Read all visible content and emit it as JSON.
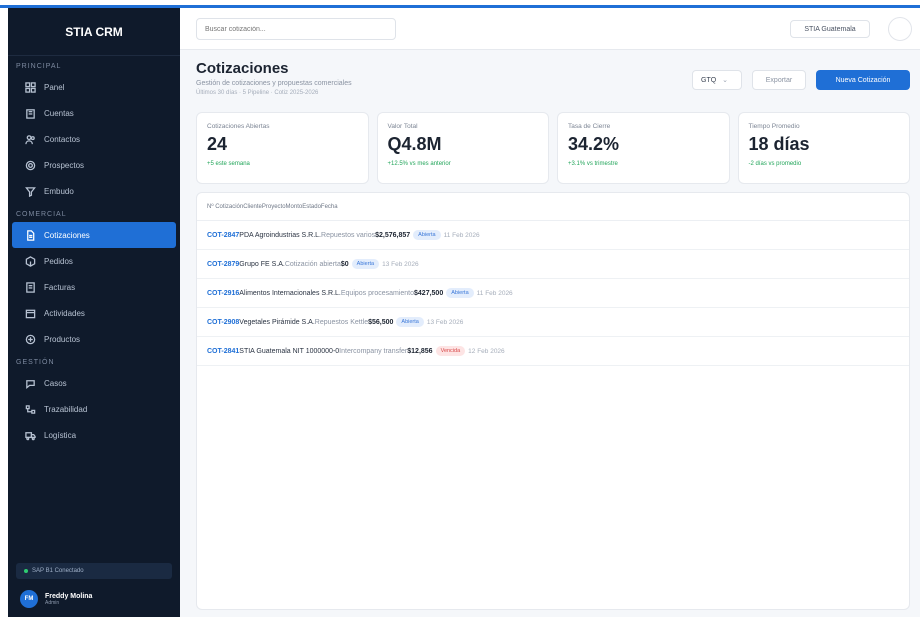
{
  "brand": "STIA CRM",
  "sidebar": {
    "sections": [
      {
        "label": "PRINCIPAL",
        "items": [
          {
            "label": "Panel",
            "icon": "grid-icon"
          },
          {
            "label": "Cuentas",
            "icon": "building-icon"
          },
          {
            "label": "Contactos",
            "icon": "users-icon"
          },
          {
            "label": "Prospectos",
            "icon": "target-icon"
          },
          {
            "label": "Embudo",
            "icon": "funnel-icon"
          }
        ]
      },
      {
        "label": "COMERCIAL",
        "items": [
          {
            "label": "Cotizaciones",
            "icon": "document-icon",
            "active": true
          },
          {
            "label": "Pedidos",
            "icon": "box-icon"
          },
          {
            "label": "Facturas",
            "icon": "invoice-icon"
          },
          {
            "label": "Actividades",
            "icon": "calendar-icon"
          },
          {
            "label": "Productos",
            "icon": "package-icon"
          }
        ]
      },
      {
        "label": "GESTIÓN",
        "items": [
          {
            "label": "Casos",
            "icon": "chat-icon"
          },
          {
            "label": "Trazabilidad",
            "icon": "trace-icon"
          },
          {
            "label": "Logística",
            "icon": "truck-icon"
          }
        ]
      }
    ],
    "online_text": "SAP B1 Conectado",
    "user": {
      "initials": "FM",
      "name": "Freddy Molina",
      "role": "Admin"
    }
  },
  "header": {
    "search_placeholder": "Buscar cotización...",
    "company": "STIA Guatemala"
  },
  "page": {
    "title": "Cotizaciones",
    "subtitle": "Gestión de cotizaciones y propuestas comerciales",
    "meta": "Últimos 30 días · 5 Pipeline · Cotiz 2025-2026",
    "currency_select": "GTQ",
    "export_label": "Exportar",
    "new_label": "Nueva Cotización"
  },
  "kpis": [
    {
      "label": "Cotizaciones Abiertas",
      "value": "24",
      "delta": "+5 este semana"
    },
    {
      "label": "Valor Total",
      "value": "Q4.8M",
      "delta": "+12.5% vs mes anterior"
    },
    {
      "label": "Tasa de Cierre",
      "value": "34.2%",
      "delta": "+3.1% vs trimestre"
    },
    {
      "label": "Tiempo Promedio",
      "value": "18 días",
      "delta": "-2 días vs promedio"
    }
  ],
  "table": {
    "header": "Nº CotizaciónClienteProyectoMontoEstadoFecha",
    "rows": [
      {
        "id": "COT-2847",
        "client": "PDA Agroindustrias S.R.L.",
        "project": "Repuestos varios",
        "amount": "$2,576,857",
        "status": "Abierta",
        "status_type": "abierta",
        "date": "11 Feb 2026"
      },
      {
        "id": "COT-2879",
        "client": "Grupo FE S.A.",
        "project": "Cotización abierta",
        "amount": "$0",
        "status": "Abierta",
        "status_type": "abierta",
        "date": "13 Feb 2026"
      },
      {
        "id": "COT-2916",
        "client": "Alimentos Internacionales S.R.L.",
        "project": "Equipos procesamiento",
        "amount": "$427,500",
        "status": "Abierta",
        "status_type": "abierta",
        "date": "11 Feb 2026"
      },
      {
        "id": "COT-2908",
        "client": "Vegetales Pirámide S.A.",
        "project": "Repuestos Kettle",
        "amount": "$56,500",
        "status": "Abierta",
        "status_type": "abierta",
        "date": "13 Feb 2026"
      },
      {
        "id": "COT-2841",
        "client": "STIA Guatemala NIT 1000000-0",
        "project": "Intercompany transfer",
        "amount": "$12,856",
        "status": "Vencida",
        "status_type": "vencida",
        "date": "12 Feb 2026"
      }
    ]
  }
}
